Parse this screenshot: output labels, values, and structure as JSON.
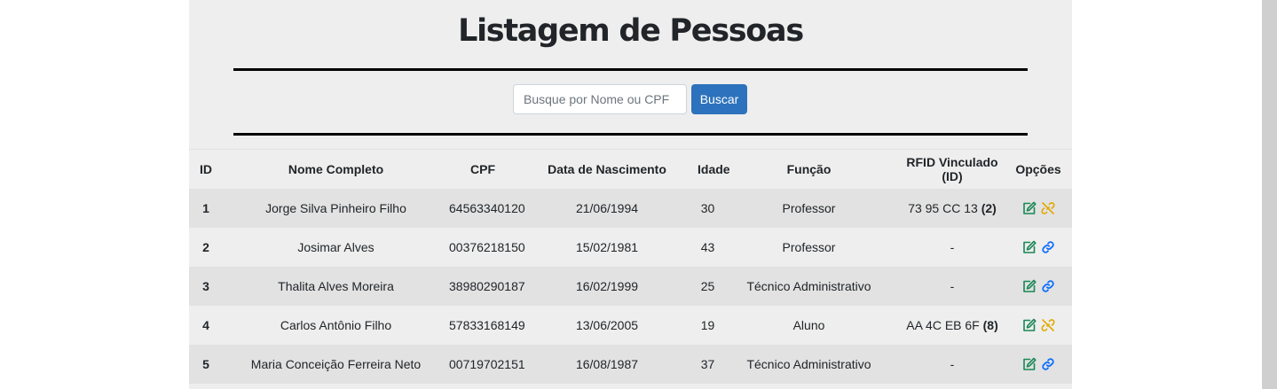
{
  "page": {
    "title": "Listagem de Pessoas"
  },
  "search": {
    "placeholder": "Busque por Nome ou CPF",
    "value": "",
    "button_label": "Buscar"
  },
  "table": {
    "headers": [
      "ID",
      "Nome Completo",
      "CPF",
      "Data de Nascimento",
      "Idade",
      "Função",
      "RFID Vinculado (ID)",
      "Opções"
    ],
    "rows": [
      {
        "id": "1",
        "name": "Jorge Silva Pinheiro Filho",
        "cpf": "64563340120",
        "birth": "21/06/1994",
        "age": "30",
        "role": "Professor",
        "rfid": "73 95 CC 13",
        "rfid_id": "(2)",
        "edit_icon": "edit-icon",
        "link_icon": "unlink-icon"
      },
      {
        "id": "2",
        "name": "Josimar Alves",
        "cpf": "00376218150",
        "birth": "15/02/1981",
        "age": "43",
        "role": "Professor",
        "rfid": "-",
        "rfid_id": "",
        "edit_icon": "edit-icon",
        "link_icon": "link-icon"
      },
      {
        "id": "3",
        "name": "Thalita Alves Moreira",
        "cpf": "38980290187",
        "birth": "16/02/1999",
        "age": "25",
        "role": "Técnico Administrativo",
        "rfid": "-",
        "rfid_id": "",
        "edit_icon": "edit-icon",
        "link_icon": "link-icon"
      },
      {
        "id": "4",
        "name": "Carlos Antônio Filho",
        "cpf": "57833168149",
        "birth": "13/06/2005",
        "age": "19",
        "role": "Aluno",
        "rfid": "AA 4C EB 6F",
        "rfid_id": "(8)",
        "edit_icon": "edit-icon",
        "link_icon": "unlink-icon"
      },
      {
        "id": "5",
        "name": "Maria Conceição Ferreira Neto",
        "cpf": "00719702151",
        "birth": "16/08/1987",
        "age": "37",
        "role": "Técnico Administrativo",
        "rfid": "-",
        "rfid_id": "",
        "edit_icon": "edit-icon",
        "link_icon": "link-icon"
      }
    ]
  },
  "colors": {
    "panel_bg": "#eeeeee",
    "row_striped": "#e2e2e2",
    "primary_button": "#2d72bd",
    "edit_icon": "#198754",
    "link_icon": "#0d6efd",
    "unlink_icon": "#e0a800"
  }
}
